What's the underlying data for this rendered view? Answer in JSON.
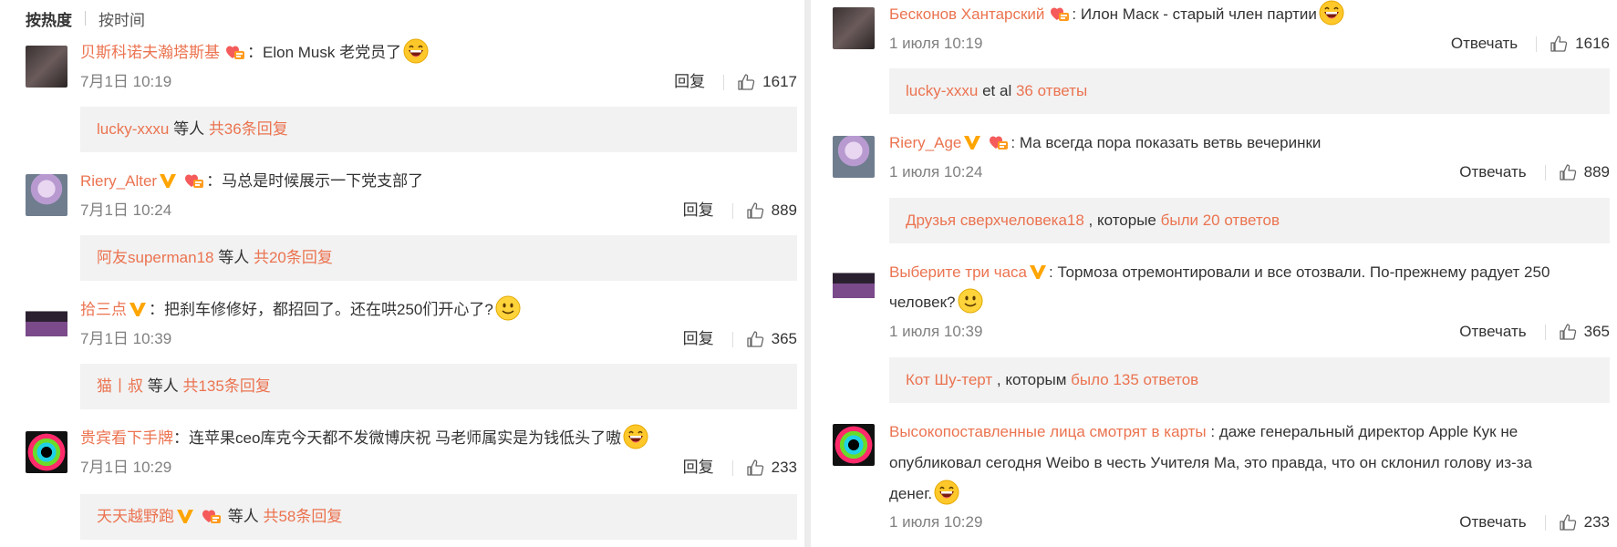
{
  "left": {
    "sort_tabs": {
      "active": "按热度",
      "other": "按时间"
    },
    "comments": [
      {
        "username": "贝斯科诺夫瀚塔斯基",
        "text": "Elon Musk 老党员了",
        "time": "7月1日 10:19",
        "reply_label": "回复",
        "likes": "1617",
        "replies": {
          "users": "lucky-xxxu",
          "mid": " 等人 ",
          "count": "共36条回复"
        }
      },
      {
        "username": "Riery_Alter",
        "text": "马总是时候展示一下党支部了",
        "time": "7月1日 10:24",
        "reply_label": "回复",
        "likes": "889",
        "replies": {
          "users": "阿友superman18",
          "mid": " 等人 ",
          "count": "共20条回复"
        }
      },
      {
        "username": "拾三点",
        "text": "把刹车修修好，都招回了。还在哄250们开心了?",
        "time": "7月1日 10:39",
        "reply_label": "回复",
        "likes": "365",
        "replies": {
          "users": "猫丨叔",
          "mid": " 等人 ",
          "count": "共135条回复"
        }
      },
      {
        "username": "贵宾看下手牌",
        "text": "连苹果ceo库克今天都不发微博庆祝 马老师属实是为钱低头了嗷",
        "time": "7月1日 10:29",
        "reply_label": "回复",
        "likes": "233",
        "replies": {
          "users": "天天越野跑",
          "mid": " 等人 ",
          "count": "共58条回复"
        }
      }
    ]
  },
  "right": {
    "comments": [
      {
        "username": "Бесконов Хантарский",
        "text": "Илон Маск - старый член партии",
        "time": "1 июля 10:19",
        "reply_label": "Отвечать",
        "likes": "1616",
        "replies": {
          "users": "lucky-xxxu",
          "mid": " et al ",
          "count": "36 ответы"
        }
      },
      {
        "username": "Riery_Age",
        "text": "Ма всегда пора показать ветвь вечеринки",
        "time": "1 июля 10:24",
        "reply_label": "Отвечать",
        "likes": "889",
        "replies": {
          "users": "Друзья сверхчеловека18",
          "mid": " , которые ",
          "count": "были 20 ответов"
        }
      },
      {
        "username": "Выберите три часа",
        "text_line1": "Тормоза отремонтировали и все отозвали. По-прежнему радует 250",
        "text_line2": "человек?",
        "time": "1 июля 10:39",
        "reply_label": "Отвечать",
        "likes": "365",
        "replies": {
          "users": "Кот Шу-терт",
          "mid": " , которым ",
          "count": "было 135 ответов"
        }
      },
      {
        "username": "Высокопоставленные лица смотрят в карты",
        "text_line1": " : даже генеральный директор Apple Кук не",
        "text_line2": "опубликовал сегодня Weibo в честь Учителя Ма, это правда, что он склонил голову из-за",
        "text_line3": "денег.",
        "time": "1 июля 10:29",
        "reply_label": "Отвечать",
        "likes": "233"
      }
    ]
  },
  "colors": {
    "username": "#eb7350",
    "reply_bg": "#f2f2f2",
    "meta": "#808080",
    "badge": "#ffa500"
  }
}
